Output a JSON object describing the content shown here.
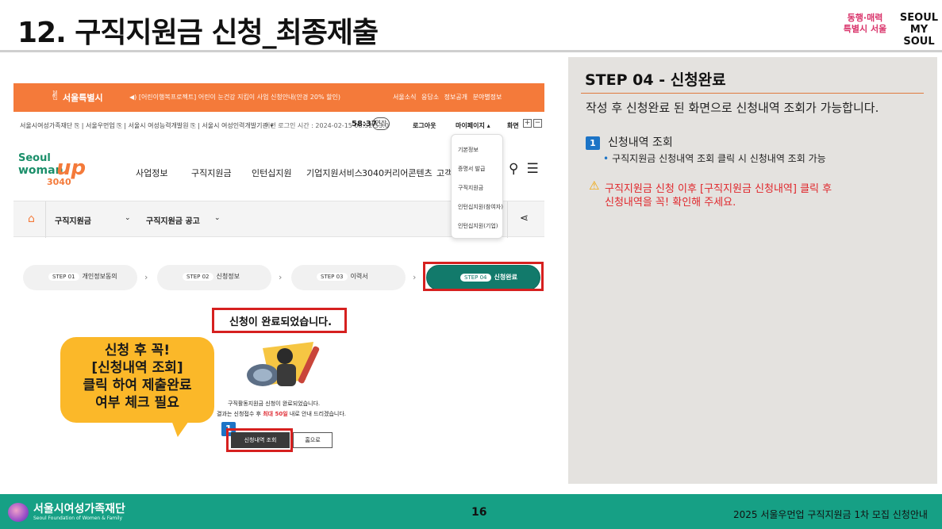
{
  "slide": {
    "title": "12. 구직지원금 신청_최종제출",
    "logo_left_line1": "동행·매력",
    "logo_left_line2": "특별시 서울",
    "logo_right_line1": "SEOUL",
    "logo_right_line2": "MY SOUL"
  },
  "site": {
    "top_bar": {
      "city_name": "서울특별시",
      "notice": "◀) [어린이행복프로젝트] 어린이 눈건강 지킴이 사업 신청안내(안경 20% 할인)",
      "links": "서울소식 응답소 정보공개 분야별정보"
    },
    "util_bar": {
      "left_links": "서울시여성가족재단 ⎘ | 서울우먼업 ⎘ | 서울시 여성능력개발원 ⎘ | 서울시 여성인력개발기관 ▾",
      "last_login": "이전 로그인 시간 : 2024-02-15 08:52:53.0",
      "timer": "58:37",
      "extend": "연장",
      "logout": "로그아웃",
      "mypage": "마이페이지 ▴",
      "font_size": "화면",
      "plus": "+",
      "minus": "−"
    },
    "brand": {
      "line1": "Seoul",
      "line2": "woman",
      "line3": "up",
      "line4": "3040"
    },
    "gnb": [
      "사업정보",
      "구직지원금",
      "인턴십지원",
      "기업지원서비스",
      "3040커리어콘텐츠",
      "고객"
    ],
    "dropdown": [
      "기본정보",
      "증명서 발급",
      "구직지원금",
      "인턴십지원(참여자)",
      "인턴십지원(기업)"
    ],
    "breadcrumb": {
      "sel1": "구직지원금",
      "sel2": "구직지원금 공고",
      "arrow": "⌄"
    },
    "steps": [
      {
        "num": "STEP 01",
        "label": "개인정보동의"
      },
      {
        "num": "STEP 02",
        "label": "신청정보"
      },
      {
        "num": "STEP 03",
        "label": "이력서"
      },
      {
        "num": "STEP 04",
        "label": "신청완료"
      }
    ],
    "step_arrow": "›",
    "done_title": "신청이 완료되었습니다.",
    "done_msg1": "구직활동지원금 신청이 완료되었습니다.",
    "done_msg2_pre": "결과는 신청접수 후 ",
    "done_msg2_bold": "최대 50일",
    "done_msg2_post": " 내로 안내 드리겠습니다.",
    "btn_history": "신청내역 조회",
    "btn_home": "홈으로",
    "badge": "1"
  },
  "callout": {
    "line1": "신청 후 꼭!",
    "line2": "[신청내역 조회]",
    "line3": "클릭 하여 제출완료",
    "line4": "여부 체크 필요"
  },
  "panel": {
    "step_title": "STEP 04 - 신청완료",
    "desc": "작성 후 신청완료 된 화면으로 신청내역 조회가 가능합니다.",
    "item_badge": "1",
    "item_title": "신청내역 조회",
    "item_sub": "구직지원금 신청내역 조회 클릭 시 신청내역 조회 가능",
    "warn_line1": "구직지원금 신청 이후 [구직지원금 신청내역] 클릭 후",
    "warn_line2": "신청내역을 꼭! 확인해 주세요."
  },
  "footer": {
    "org": "서울시여성가족재단",
    "org_en": "Seoul Foundation of Women & Family",
    "page": "16",
    "doc": "2025 서울우먼업 구직지원금 1차 모집 신청안내"
  },
  "colors": {
    "accent_orange": "#f47a3a",
    "step_active": "#127a6b",
    "highlight_red": "#d6201f",
    "callout_yellow": "#fbb829",
    "footer_green": "#16a085",
    "badge_blue": "#1c74c6"
  }
}
